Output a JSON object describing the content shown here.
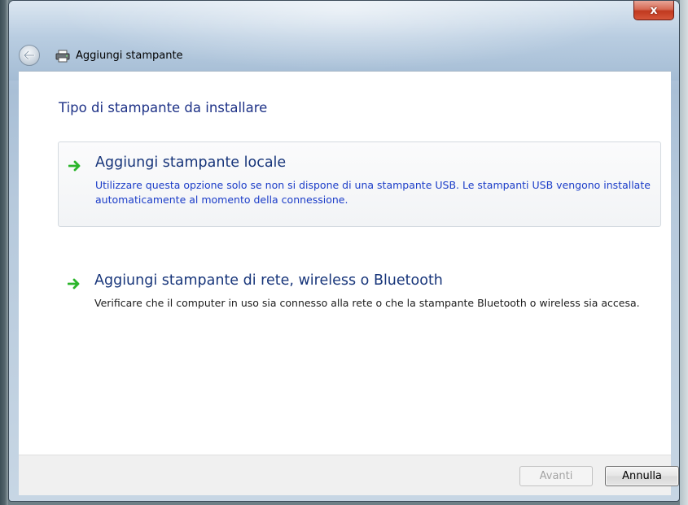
{
  "window": {
    "title": "Aggiungi stampante",
    "close_label": "x"
  },
  "icons": {
    "back": "back-arrow-icon",
    "printer": "printer-icon",
    "option_arrow": "green-arrow-icon"
  },
  "page": {
    "title": "Tipo di stampante da installare"
  },
  "options": [
    {
      "title": "Aggiungi stampante locale",
      "description": "Utilizzare questa opzione solo se non si dispone di una stampante USB. Le stampanti USB vengono installate automaticamente al momento della connessione.",
      "selected": true
    },
    {
      "title": "Aggiungi stampante di rete, wireless o Bluetooth",
      "description": "Verificare che il computer in uso sia connesso alla rete o che la stampante Bluetooth o wireless sia accesa.",
      "selected": false
    }
  ],
  "footer": {
    "next_label": "Avanti",
    "next_enabled": false,
    "cancel_label": "Annulla"
  },
  "colors": {
    "title_blue": "#1e3287",
    "option_title_blue": "#17357a",
    "arrow_green": "#2bb52b",
    "close_red": "#c0391f"
  }
}
